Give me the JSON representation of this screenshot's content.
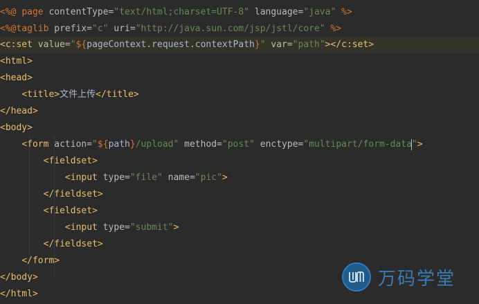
{
  "editor": {
    "lines": [
      "<%@ page contentType=\"text/html;charset=UTF-8\" language=\"java\" %>",
      "<%@taglib prefix=\"c\" uri=\"http://java.sun.com/jsp/jstl/core\" %>",
      "<c:set value=\"${pageContext.request.contextPath}\" var=\"path\"></c:set>",
      "<html>",
      "<head>",
      "    <title>文件上传</title>",
      "</head>",
      "<body>",
      "    <form action=\"${path}/upload\" method=\"post\" enctype=\"multipart/form-data\">",
      "        <fieldset>",
      "            <input type=\"file\" name=\"pic\">",
      "        </fieldset>",
      "        <fieldset>",
      "            <input type=\"submit\">",
      "        </fieldset>",
      "    </form>",
      "</body>",
      "</html>"
    ],
    "highlighted_line": 3
  },
  "watermark": {
    "logo_icon": "wm-logo-icon",
    "text": "万码学堂"
  },
  "colors": {
    "background": "#2b2b2b",
    "tag": "#e8bf6a",
    "attribute_value": "#6a8759",
    "keyword": "#cc7832"
  }
}
